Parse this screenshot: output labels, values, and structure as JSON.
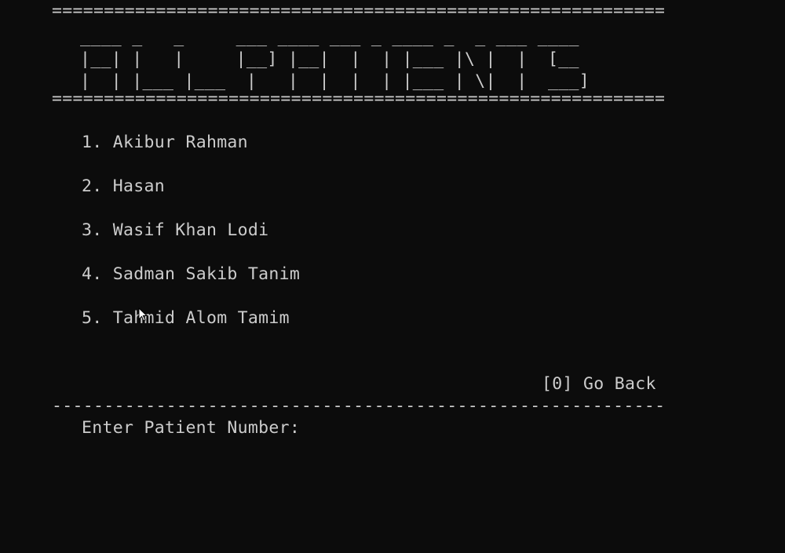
{
  "separator_double": "============================================================",
  "separator_single": "------------------------------------------------------------",
  "banner": {
    "ascii_lines": [
      "____ _   _     ___ ____ ___ _ ____ _  _ ___ ____",
      "|__| |   |     |__] |__|  |  | |___ |\\ |  |  [__ ",
      "|  | |___ |___  |   |  |  |  | |___ | \\|  |  ___]"
    ],
    "text": "ALL PATIENTS"
  },
  "patients": [
    {
      "number": "1.",
      "name": "Akibur Rahman"
    },
    {
      "number": "2.",
      "name": "Hasan"
    },
    {
      "number": "3.",
      "name": "Wasif Khan Lodi"
    },
    {
      "number": "4.",
      "name": "Sadman Sakib Tanim"
    },
    {
      "number": "5.",
      "name": "Tahmid Alom Tamim"
    }
  ],
  "go_back": "[0] Go Back",
  "prompt": "Enter Patient Number:"
}
